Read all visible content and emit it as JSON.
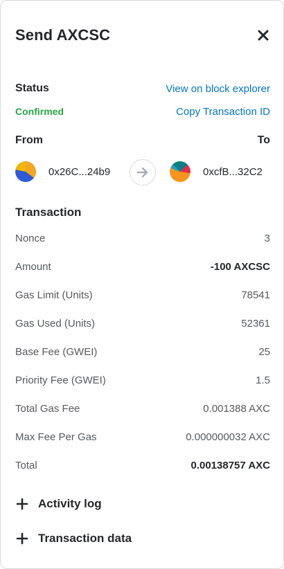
{
  "header": {
    "title": "Send AXCSC",
    "close_icon": "close-icon"
  },
  "status": {
    "heading": "Status",
    "value": "Confirmed",
    "view_explorer": "View on block explorer",
    "copy_tx_id": "Copy Transaction ID",
    "value_color": "#28a745",
    "link_color": "#0376c9"
  },
  "parties": {
    "from_label": "From",
    "to_label": "To",
    "from_address": "0x26C...24b9",
    "to_address": "0xcfB...32C2"
  },
  "transaction": {
    "heading": "Transaction",
    "rows": [
      {
        "label": "Nonce",
        "value": "3"
      },
      {
        "label": "Amount",
        "value": "-100 AXCSC"
      },
      {
        "label": "Gas Limit (Units)",
        "value": "78541"
      },
      {
        "label": "Gas Used (Units)",
        "value": "52361"
      },
      {
        "label": "Base Fee (GWEI)",
        "value": "25"
      },
      {
        "label": "Priority Fee (GWEI)",
        "value": "1.5"
      },
      {
        "label": "Total Gas Fee",
        "value": "0.001388 AXC"
      },
      {
        "label": "Max Fee Per Gas",
        "value": "0.000000032 AXC"
      },
      {
        "label": "Total",
        "value": "0.00138757 AXC"
      }
    ]
  },
  "expanders": {
    "activity_log": "Activity log",
    "transaction_data": "Transaction data"
  }
}
